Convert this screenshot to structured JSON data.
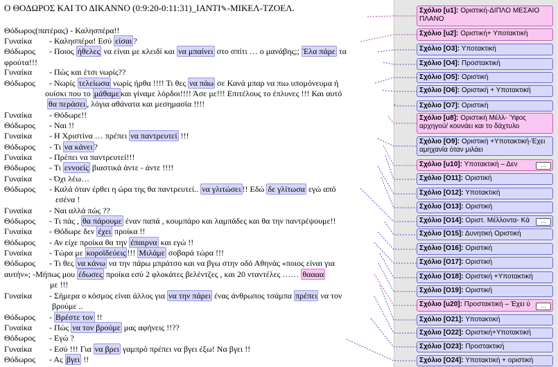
{
  "document": {
    "title": "Ο ΘΟΔΩΡΟΣ  ΚΑΙ ΤΟ ΔΙΚΑΝΝΟ  (0:9:20-0:11:31)_ΙΑΝΤΙ",
    "title_suffix": "-ΜΙΚΕΛ-ΤΖΟΕΛ."
  },
  "comments": [
    {
      "label": "Σχόλιο [u1]:",
      "text": "Οριστική-ΔΙΠΛΟ ΜΕΣΑΙΟ ΠΛΑΝΟ",
      "color": "pink"
    },
    {
      "label": "Σχόλιο [u2]:",
      "text": "Οριστική+ Υποτακτική",
      "color": "pink"
    },
    {
      "label": "Σχόλιο [O3]:",
      "text": "Υποτακτική",
      "color": "blue"
    },
    {
      "label": "Σχόλιο [O4]:",
      "text": "Προστακτική",
      "color": "blue"
    },
    {
      "label": "Σχόλιο [O5]:",
      "text": "Οριστική",
      "color": "blue"
    },
    {
      "label": "Σχόλιο [O6]:",
      "text": "Οριστική + Υποτακτική",
      "color": "blue"
    },
    {
      "label": "Σχόλιο [O7]:",
      "text": "Οριστική",
      "color": "blue"
    },
    {
      "label": "Σχόλιο [u8]:",
      "text": "Οριστική Μέλλ- Ύφος αρχηγού/ κουνάει και το δάχτυλο",
      "color": "pink"
    },
    {
      "label": "Σχόλιο [O9]:",
      "text": "Οριστική +Υποτακτική-Έχει αμηχανία όταν μιλάει",
      "color": "blue"
    },
    {
      "label": "Σχόλιο [u10]:",
      "text": "Υποτακτική – Δεν",
      "color": "pink"
    },
    {
      "label": "Σχόλιο [O11]:",
      "text": "Οριστική",
      "color": "blue"
    },
    {
      "label": "Σχόλιο [O12]:",
      "text": "Υποτακτική",
      "color": "blue"
    },
    {
      "label": "Σχόλιο [O13]:",
      "text": "Οριστική",
      "color": "blue"
    },
    {
      "label": "Σχόλιο [O14]:",
      "text": "Οριστ. Μέλλοντα- Κά",
      "color": "blue"
    },
    {
      "label": "Σχόλιο [O15]:",
      "text": "Δυνητική Οριστική",
      "color": "blue"
    },
    {
      "label": "Σχόλιο [O16]:",
      "text": "Οριστική",
      "color": "blue"
    },
    {
      "label": "Σχόλιο [O17]:",
      "text": "Οριστική",
      "color": "blue"
    },
    {
      "label": "Σχόλιο [O18]:",
      "text": "Οριστική +Υποτακτική",
      "color": "blue"
    },
    {
      "label": "Σχόλιο [O19]:",
      "text": "Οριστική",
      "color": "blue"
    },
    {
      "label": "Σχόλιο [u20]:",
      "text": "Προστακτική – Έχει ύ",
      "color": "pink"
    },
    {
      "label": "Σχόλιο [O21]:",
      "text": "Υποτακτική",
      "color": "blue"
    },
    {
      "label": "Σχόλιο [O22]:",
      "text": "Οριστική+Υποτακτική",
      "color": "blue"
    },
    {
      "label": "Σχόλιο [O23]:",
      "text": "Προστακτική",
      "color": "blue"
    },
    {
      "label": "Σχόλιο [O24]:",
      "text": "Υποτακτική + οριστική",
      "color": "blue"
    }
  ],
  "lines": [
    {
      "speaker": "Θόδωρος(πατέρας)",
      "parts": [
        {
          "t": " - Καλησπέρα!!"
        }
      ]
    },
    {
      "speaker": "Γυναίκα",
      "parts": [
        {
          "t": "  - Καλησπέρα! Εσύ "
        },
        {
          "h": "είσαι"
        },
        {
          "t": "?"
        }
      ]
    },
    {
      "speaker": "Θόδωρος",
      "parts": [
        {
          "t": "  - Ποιος "
        },
        {
          "h": "ήθελες"
        },
        {
          "t": " να είναι με κλειδί και "
        },
        {
          "h": "να μπαίνει"
        },
        {
          "t": " στο σπίτι … ο μανάβης;;  "
        },
        {
          "h": "Έλα πάρε"
        },
        {
          "t": " τα"
        }
      ]
    },
    {
      "cont": "φρούτα!!!"
    },
    {
      "speaker": "Γυναίκα",
      "parts": [
        {
          "t": "  - Πώς και έτσι νωρίς??"
        }
      ]
    },
    {
      "speaker": "Θόδωρος",
      "parts": [
        {
          "t": "  - Νωρίς "
        },
        {
          "h": "τελείωσα"
        },
        {
          "t": " νωρίς ήρθα !!!!  Τι θες "
        },
        {
          "h": "να πάω"
        },
        {
          "t": " σε Κανά μπαρ να πιω υπομόνευμα ή"
        }
      ]
    },
    {
      "cont": "ουίσκι που το "
    },
    {
      "cont": "θα  περάσει"
    },
    {
      "speaker": "Γυναίκα",
      "parts": [
        {
          "t": "  -  Θόδωρε!!"
        }
      ]
    },
    {
      "speaker": "Θόδωρος",
      "parts": [
        {
          "t": "  - Ναι !!"
        }
      ]
    },
    {
      "speaker": "Γυναίκα",
      "parts": [
        {
          "t": "  - Η Χριστίνα … πρέπει "
        },
        {
          "h": "να παντρευτεί"
        },
        {
          "t": " !!!"
        }
      ]
    },
    {
      "speaker": "Θόδωρος",
      "parts": [
        {
          "t": "  - Τι "
        },
        {
          "h": "να κάνει"
        },
        {
          "t": "?"
        }
      ]
    },
    {
      "speaker": "Γυναίκα",
      "parts": [
        {
          "t": "  - Πρέπει να παντρευτεί!!!"
        }
      ]
    },
    {
      "speaker": "Θόδωρος",
      "parts": [
        {
          "t": "  - Τι "
        },
        {
          "h": "εννοείς"
        },
        {
          "t": " βιαστικά άντε - άντε !!!!"
        }
      ]
    },
    {
      "speaker": "Γυναίκα",
      "parts": [
        {
          "t": "  -  Όχι λέω…"
        }
      ]
    },
    {
      "speaker": "Θόδωρος",
      "parts": [
        {
          "t": "  -   Καλά όταν έρθει η ώρα της θα παντρευτεί.. "
        },
        {
          "h": "να γλιτώσει"
        },
        {
          "t": "!! Εδώ  "
        },
        {
          "h": "δε γλίτωσα"
        },
        {
          "t": " εγώ από"
        }
      ]
    },
    {
      "cont": "εσένα !"
    },
    {
      "speaker": "Γυναίκα",
      "parts": [
        {
          "t": "  - Ναι αλλά πώς ??"
        }
      ]
    },
    {
      "speaker": "Θόδωρος",
      "parts": [
        {
          "t": "  - Τι πάς ,  "
        },
        {
          "h": "θα πάρουμε"
        },
        {
          "t": " έναν παπά , κουμπάρο και λαμπάδες και θα την παντρέψουμε!!"
        }
      ]
    },
    {
      "speaker": "Γυναίκα",
      "parts": [
        {
          "t": "  - Θόδωρε δεν  "
        },
        {
          "h": "έχει"
        },
        {
          "t": " προίκα !!"
        }
      ]
    },
    {
      "speaker": "Θόδωρος",
      "parts": [
        {
          "t": "  - Αν είχε προίκα θα την "
        },
        {
          "h": "έπαιρνα"
        },
        {
          "t": " και εγώ !!"
        }
      ]
    },
    {
      "speaker": "Γυναίκα",
      "parts": [
        {
          "t": "  - Τώρα με "
        },
        {
          "h": "κοροϊδεύεις"
        },
        {
          "t": "!!! "
        },
        {
          "h": "Μιλάμε"
        },
        {
          "t": " σοβαρά τώρα !!!"
        }
      ]
    },
    {
      "speaker": "Θόδωρος",
      "parts": [
        {
          "t": "  - Τι θες "
        },
        {
          "h": "να κάνω"
        },
        {
          "t": " να την πάρω μπράτσο  και να βγω στην οδό Αθηνάς  «ποιος είναι για"
        }
      ]
    },
    {
      "cont": "αυτήν»; "
    },
    {
      "cont": "με !!!"
    },
    {
      "speaker": "Γυναίκα",
      "parts": [
        {
          "t": "  - Σήμερα ο κόσμος είναι άλλος  για "
        },
        {
          "h": "να την πάρει"
        },
        {
          "t": " ένας άνθρωπος τσάμπα "
        },
        {
          "h": "πρέπει"
        },
        {
          "t": " να τον"
        }
      ]
    },
    {
      "cont": "βρούμε .."
    },
    {
      "speaker": "Θόδωρος",
      "parts": [
        {
          "t": "  - "
        },
        {
          "h": "Βρέστε τον"
        },
        {
          "t": " !!"
        }
      ]
    },
    {
      "speaker": "Γυναίκα",
      "parts": [
        {
          "t": "  - Πώς "
        },
        {
          "h": "να τον βρούμε"
        },
        {
          "t": " μας αφήνεις !!??"
        }
      ]
    },
    {
      "speaker": "Θόδωρος",
      "parts": [
        {
          "t": "  - Εγώ ?"
        }
      ]
    },
    {
      "speaker": "Γυναίκα",
      "parts": [
        {
          "t": "  - Εσύ !!!  Για "
        },
        {
          "h": "να βρει"
        },
        {
          "t": " γαμπρό πρέπει να βγει έξω!  Να βγει !!"
        }
      ]
    },
    {
      "speaker": "Θόδωρος",
      "parts": [
        {
          "t": "  - Ας "
        },
        {
          "h": "βγει"
        },
        {
          "t": " !!"
        }
      ]
    }
  ],
  "extra": {
    "ouiski_rest": "και γίναμε λόρδοι!!!!   Άσε με!!!   Επιτέλους το έπλυνες !!!   Και αυτό",
    "ouiski_h": "μάθαμε",
    "tha_rest": ",  λόγια αθάνατα και μεσημασία     !!!!",
    "milaw_prefix": "-Μήπως μου ",
    "milaw_h": "έδωσες",
    "milaw_rest": " προίκα εσύ  2 φλοκάτες  βελέντζες  , και  20 νταντέλες …… ",
    "milaw_h2": "θαααα",
    "more_label": "…"
  }
}
